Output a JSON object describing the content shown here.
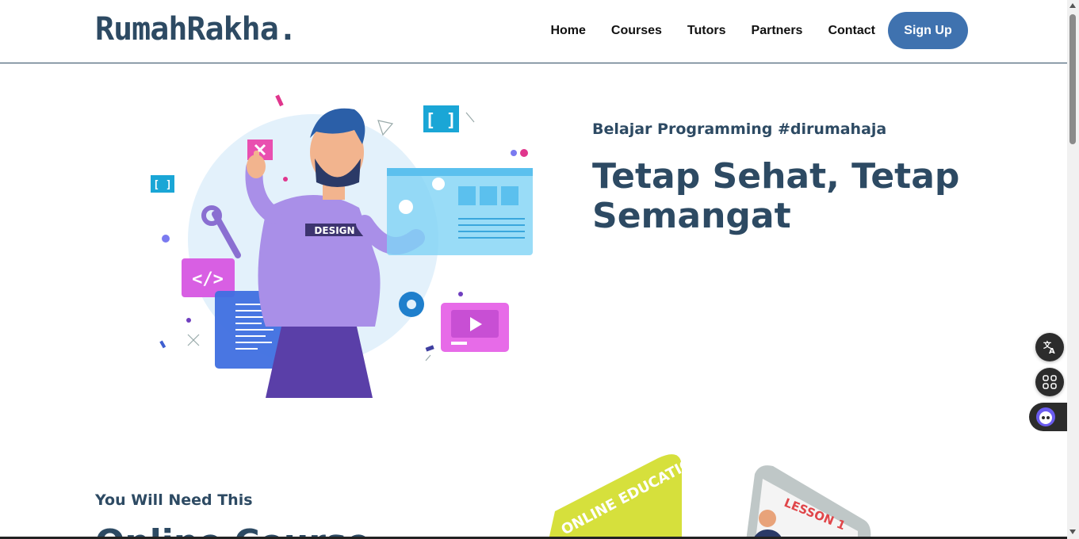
{
  "header": {
    "logo": "RumahRakha.",
    "nav": [
      "Home",
      "Courses",
      "Tutors",
      "Partners",
      "Contact"
    ],
    "signup_label": "Sign Up"
  },
  "hero": {
    "subtitle": "Belajar Programming #dirumahaja",
    "title": "Tetap Sehat, Tetap Semangat",
    "illustration_badge": "DESIGN"
  },
  "section2": {
    "subtitle": "You Will Need This",
    "title": "Online Course",
    "card_text": "ONLINE EDUCATION",
    "lesson_text": "LESSON 1"
  },
  "tools": {
    "translate_icon": "translate-icon",
    "apps_icon": "apps-grid-icon",
    "assistant_icon": "assistant-icon"
  },
  "colors": {
    "brand": "#2d4a63",
    "accent": "#3f72af"
  }
}
